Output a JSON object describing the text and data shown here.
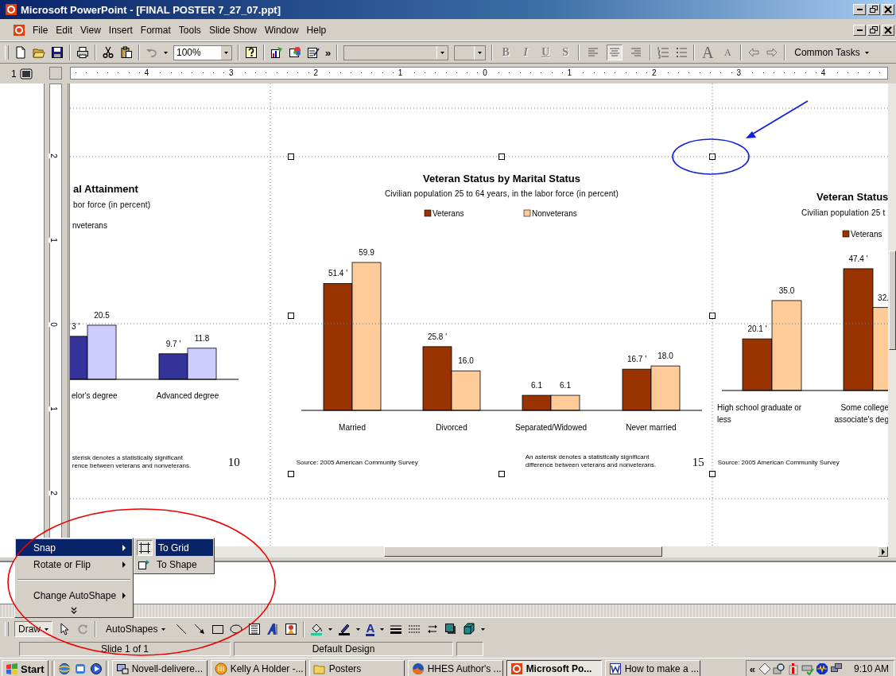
{
  "window": {
    "title": "Microsoft PowerPoint - [FINAL POSTER 7_27_07.ppt]"
  },
  "menu": [
    {
      "label": "File"
    },
    {
      "label": "Edit"
    },
    {
      "label": "View"
    },
    {
      "label": "Insert"
    },
    {
      "label": "Format"
    },
    {
      "label": "Tools"
    },
    {
      "label": "Slide Show"
    },
    {
      "label": "Window"
    },
    {
      "label": "Help"
    }
  ],
  "toolbar": {
    "zoom": "100%",
    "overflow": "»",
    "format_buttons": [
      {
        "label": "B",
        "disabled": true
      },
      {
        "label": "I",
        "disabled": true
      },
      {
        "label": "U",
        "disabled": true
      },
      {
        "label": "S",
        "disabled": true
      }
    ],
    "align_buttons": [
      {
        "selected": false
      },
      {
        "selected": true
      },
      {
        "selected": false
      }
    ],
    "font_size_buttons": [
      {
        "label": "A"
      },
      {
        "label": "A"
      }
    ],
    "common_tasks": "Common Tasks"
  },
  "slide_tab": {
    "number": "1"
  },
  "horizontal_ruler": [
    "4",
    "3",
    "2",
    "1",
    "0",
    "1",
    "2",
    "3",
    "4"
  ],
  "vertical_ruler": [
    "2",
    "1",
    "0",
    "1",
    "2"
  ],
  "charts": [
    {
      "subtitle": "bor force (in percent)",
      "cut_value_label": "3 '",
      "footnote": [
        "sterisk denotes a statistically significant",
        "rence between veterans and nonveterans."
      ],
      "page_number": "10",
      "chart_data": {
        "type": "bar",
        "title": "al Attainment",
        "legend": true,
        "categories": [
          "elor's degree",
          "Advanced degree"
        ],
        "series": [
          {
            "color": "#333399",
            "values": [
              16.3,
              9.7
            ],
            "value_labels": [
              null,
              "9.7 '"
            ]
          },
          {
            "name": "nveterans",
            "color": "#ccccff",
            "values": [
              20.5,
              11.8
            ],
            "value_labels": [
              "20.5",
              "11.8"
            ]
          }
        ]
      }
    },
    {
      "subtitle": "Civilian population 25 to 64 years, in the labor force (in percent)",
      "source": "Source: 2005 American Community Survey",
      "footnote": [
        "An asterisk denotes a statistically significant",
        "difference between veterans and nonveterans."
      ],
      "page_number": "15",
      "selected": true,
      "chart_data": {
        "type": "bar",
        "title": "Veteran Status by Marital Status",
        "legend": true,
        "categories": [
          "Married",
          "Divorced",
          "Separated/Widowed",
          "Never married"
        ],
        "series": [
          {
            "name": "Veterans",
            "color": "#993300",
            "values": [
              51.4,
              25.8,
              6.1,
              16.7
            ],
            "value_labels": [
              "51.4 '",
              "25.8 '",
              "6.1",
              "16.7 '"
            ]
          },
          {
            "name": "Nonveterans",
            "color": "#ffcc99",
            "values": [
              59.9,
              16.0,
              6.1,
              18.0
            ],
            "value_labels": [
              "59.9",
              "16.0",
              "6.1",
              "18.0"
            ]
          }
        ]
      }
    },
    {
      "subtitle": "Civilian population 25 t",
      "source": "Source: 2005 American Community Survey",
      "chart_data": {
        "type": "bar",
        "title": "Veteran Status",
        "legend": true,
        "categories": [
          "High school graduate or\nless",
          "Some college\nassociate's deg"
        ],
        "series": [
          {
            "name": "Veterans",
            "color": "#993300",
            "values": [
              20.1,
              47.4
            ],
            "value_labels": [
              "20.1 '",
              "47.4 '"
            ]
          },
          {
            "color": "#ffcc99",
            "values": [
              35.0,
              32.3
            ],
            "value_labels": [
              "35.0",
              "32."
            ]
          }
        ]
      }
    }
  ],
  "context_menu": {
    "items": [
      {
        "kind": "item",
        "label": "Snap",
        "submenu": true,
        "selected": true
      },
      {
        "kind": "item",
        "label": "Rotate or Flip",
        "submenu": true,
        "selected": false
      },
      {
        "kind": "separator"
      },
      {
        "kind": "item",
        "label": "Change AutoShape",
        "submenu": true,
        "selected": false
      },
      {
        "kind": "expand"
      }
    ],
    "submenu": [
      {
        "label": "To Grid",
        "selected": true
      },
      {
        "label": "To Shape",
        "selected": false
      }
    ]
  },
  "draw_toolbar": {
    "draw": "Draw",
    "autoshapes": "AutoShapes",
    "font_color": "A"
  },
  "status_bar": [
    "Slide 1 of 1",
    "Default Design"
  ],
  "taskbar": {
    "start": "Start",
    "tasks": [
      {
        "label": "Novell-delivere...",
        "selected": false
      },
      {
        "label": "Kelly A Holder -...",
        "selected": false
      },
      {
        "label": "Posters",
        "selected": false
      },
      {
        "label": "HHES Author's ...",
        "selected": false
      },
      {
        "label": "Microsoft Po...",
        "selected": true
      },
      {
        "label": "How to make a ...",
        "selected": false
      }
    ],
    "tray_toggle": "«",
    "clock": "9:10 AM"
  }
}
